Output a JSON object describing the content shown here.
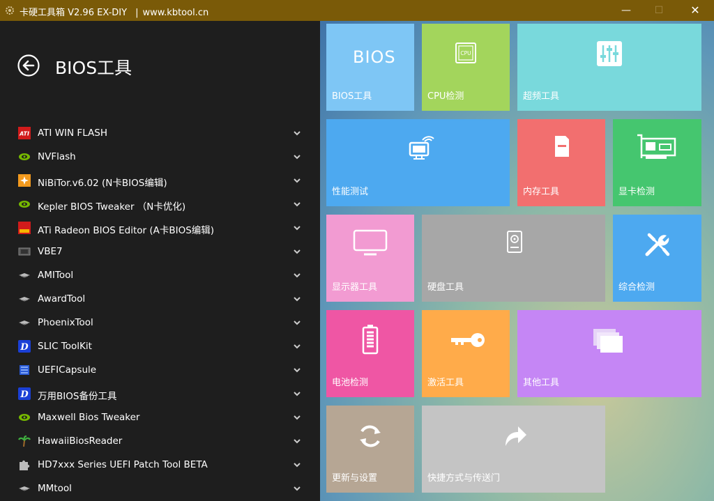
{
  "window": {
    "title": "卡硬工具箱 V2.96  EX-DIY",
    "separator": "|",
    "website": "www.kbtool.cn",
    "min_label": "—",
    "max_label": "☐",
    "close_label": "✕"
  },
  "left": {
    "title": "BIOS工具",
    "items": [
      {
        "label": "ATI WIN FLASH",
        "icon": "ati-icon"
      },
      {
        "label": "NVFlash",
        "icon": "nvidia-icon"
      },
      {
        "label": "NiBiTor.v6.02 (N卡BIOS编辑)",
        "icon": "nibitor-icon"
      },
      {
        "label": "Kepler BIOS Tweaker （N卡优化)",
        "icon": "nvidia-icon"
      },
      {
        "label": "ATi Radeon BIOS Editor (A卡BIOS编辑)",
        "icon": "ati-rbe-icon"
      },
      {
        "label": "VBE7",
        "icon": "chip-icon"
      },
      {
        "label": "AMITool",
        "icon": "tool-icon"
      },
      {
        "label": "AwardTool",
        "icon": "tool-icon"
      },
      {
        "label": "PhoenixTool",
        "icon": "tool-icon"
      },
      {
        "label": "SLIC ToolKit",
        "icon": "slic-icon"
      },
      {
        "label": "UEFICapsule",
        "icon": "uefi-icon"
      },
      {
        "label": "万用BIOS备份工具",
        "icon": "slic-icon"
      },
      {
        "label": "Maxwell Bios Tweaker",
        "icon": "nvidia-icon"
      },
      {
        "label": "HawaiiBiosReader",
        "icon": "palm-icon"
      },
      {
        "label": "HD7xxx Series UEFI Patch Tool BETA",
        "icon": "puzzle-icon"
      },
      {
        "label": "MMtool",
        "icon": "tool-icon"
      }
    ]
  },
  "tiles": {
    "bios": {
      "label": "BIOS工具",
      "icon_text": "BIOS",
      "color": "#7ec6f5"
    },
    "cpu": {
      "label": "CPU检测",
      "icon_text": "CPU",
      "color": "#a3d55c"
    },
    "oc": {
      "label": "超频工具",
      "color": "#79d9dc"
    },
    "perf": {
      "label": "性能测试",
      "color": "#4da9f0"
    },
    "memory": {
      "label": "内存工具",
      "color": "#f26f6f"
    },
    "gpu": {
      "label": "显卡检测",
      "color": "#45c66f"
    },
    "display": {
      "label": "显示器工具",
      "color": "#f29bd2"
    },
    "disk": {
      "label": "硬盘工具",
      "color": "#a7a7a7"
    },
    "general": {
      "label": "综合检测",
      "color": "#4da9f0"
    },
    "battery": {
      "label": "电池检测",
      "color": "#ef56a4"
    },
    "activate": {
      "label": "激活工具",
      "color": "#ffab4a"
    },
    "other": {
      "label": "其他工具",
      "color": "#c586f5"
    },
    "update": {
      "label": "更新与设置",
      "color": "#b6a694"
    },
    "shortcut": {
      "label": "快捷方式与传送门",
      "color": "#c4c4c4"
    }
  }
}
